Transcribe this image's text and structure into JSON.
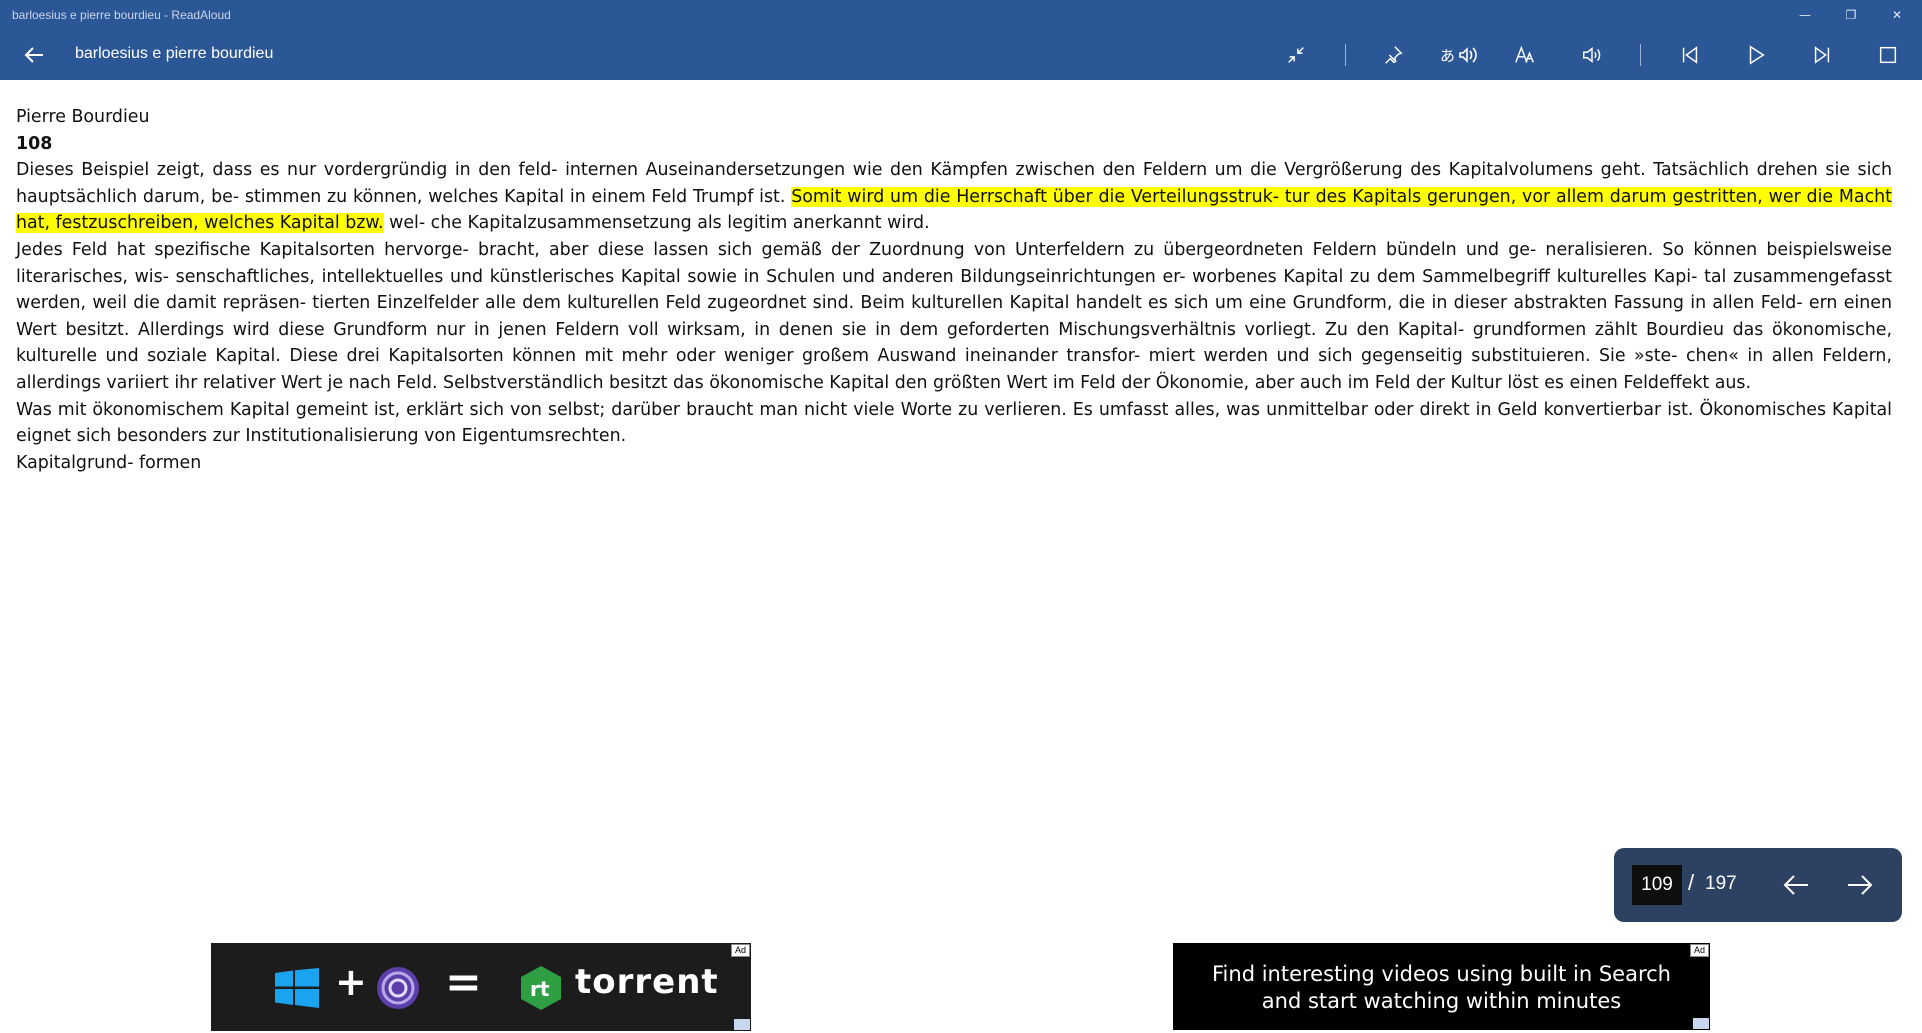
{
  "window": {
    "title": "barloesius e pierre bourdieu - ReadAloud",
    "minimize_glyph": "—",
    "restore_glyph": "❐",
    "close_glyph": "✕"
  },
  "appbar": {
    "document_title": "barloesius e pierre bourdieu",
    "icons": [
      "back-arrow-icon",
      "collapse-icon",
      "pin-icon",
      "language-voice-icon",
      "text-size-icon",
      "volume-icon",
      "skip-previous-icon",
      "play-icon",
      "skip-next-icon",
      "stop-icon"
    ]
  },
  "content": {
    "heading": "Pierre Bourdieu",
    "page_number": "108",
    "para1_before": "Dieses Beispiel zeigt, dass es nur vordergründig in den feld- internen Auseinandersetzungen wie den Kämpfen zwischen den Feldern um die Vergrößerung des Kapitalvolumens geht. Tatsächlich drehen sie sich hauptsächlich darum, be- stimmen zu können, welches Kapital in einem Feld Trumpf ist. ",
    "para1_highlight": "Somit wird um die Herrschaft über die Verteilungsstruk- tur des Kapitals gerungen, vor allem darum gestritten, wer die Macht hat, festzuschreiben, welches Kapital bzw.",
    "para1_after": " wel- che Kapitalzusammensetzung als legitim anerkannt wird.",
    "para2": "Jedes Feld hat spezifische Kapitalsorten hervorge- bracht, aber diese lassen sich gemäß der Zuordnung von Unterfeldern zu übergeordneten Feldern bündeln und ge- neralisieren. So können beispielsweise literarisches, wis- senschaftliches, intellektuelles und künstlerisches Kapital sowie in Schulen und anderen Bildungseinrichtungen er- worbenes Kapital zu dem Sammelbegriff kulturelles Kapi- tal zusammengefasst werden, weil die damit repräsen- tierten Einzelfelder alle dem kulturellen Feld zugeordnet sind. Beim kulturellen Kapital handelt es sich um eine Grundform, die in dieser abstrakten Fassung in allen Feld- ern einen Wert besitzt. Allerdings wird diese Grundform nur in jenen Feldern voll wirksam, in denen sie in dem geforderten Mischungsverhältnis vorliegt. Zu den Kapital- grundformen zählt Bourdieu das ökonomische, kulturelle und soziale Kapital. Diese drei Kapitalsorten können mit mehr oder weniger großem Auswand ineinander transfor- miert werden und sich gegenseitig substituieren. Sie »ste- chen« in allen Feldern, allerdings variiert ihr relativer Wert je nach Feld. Selbstverständlich besitzt das ökonomische Kapital den größten Wert im Feld der Ökonomie, aber auch im Feld der Kultur löst es einen Feldeffekt aus.",
    "para3": "Was mit ökonomischem Kapital gemeint ist, erklärt sich von selbst; darüber braucht man nicht viele Worte zu verlieren. Es umfasst alles, was unmittelbar oder direkt in Geld konvertierbar ist. Ökonomisches Kapital eignet sich besonders zur Institutionalisierung von Eigentumsrechten.",
    "para4": "Kapitalgrund- formen",
    "highlight_color": "#ffff00"
  },
  "pager": {
    "current_page": "109",
    "separator": "/",
    "total_pages": "197"
  },
  "ads": {
    "ad1": {
      "tag": "Ad",
      "brand": "torrent",
      "plus": "+",
      "equals": "="
    },
    "ad2": {
      "tag": "Ad",
      "line1": "Find interesting videos using built in Search",
      "line2": "and start watching within minutes"
    }
  },
  "colors": {
    "accent": "#2b5797",
    "pager_bg": "#2d4163"
  }
}
